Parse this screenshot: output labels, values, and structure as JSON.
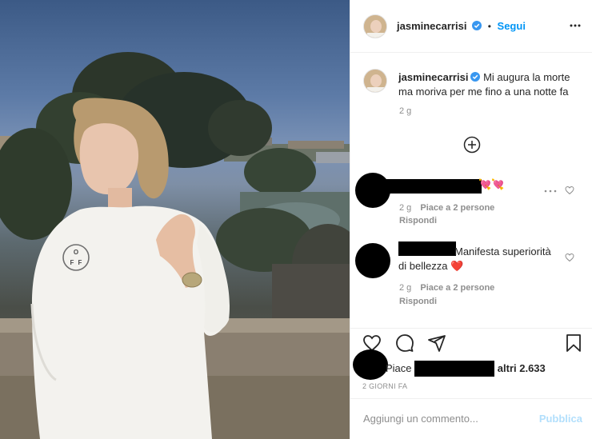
{
  "post": {
    "author": "jasminecarrisi",
    "verified": true,
    "separator": "•",
    "follow_label": "Segui",
    "caption": "Mi augura la morte ma moriva per me fino a una notte fa",
    "caption_time": "2 g",
    "photo_shirt_text": "OFF"
  },
  "comments": [
    {
      "text": "💘💘",
      "time": "2 g",
      "likes": "Piace a 2 persone",
      "reply_label": "Rispondi"
    },
    {
      "text": "Manifesta superiorità di bellezza ❤️",
      "time": "2 g",
      "likes": "Piace a 2 persone",
      "reply_label": "Rispondi"
    }
  ],
  "likes_line": {
    "prefix": "Piace",
    "suffix": "altri 2.633"
  },
  "post_date": "2 GIORNI FA",
  "comment_box": {
    "placeholder": "Aggiungi un commento...",
    "publish_label": "Pubblica"
  },
  "icons": [
    "verified-badge-icon",
    "more-options-icon",
    "plus-circle-icon",
    "heart-icon",
    "comment-icon",
    "share-icon",
    "bookmark-icon"
  ],
  "colors": {
    "accent": "#0095f6",
    "publish_disabled": "#b2dffc",
    "like_heart": "#ed4956",
    "muted": "#8e8e8e"
  }
}
